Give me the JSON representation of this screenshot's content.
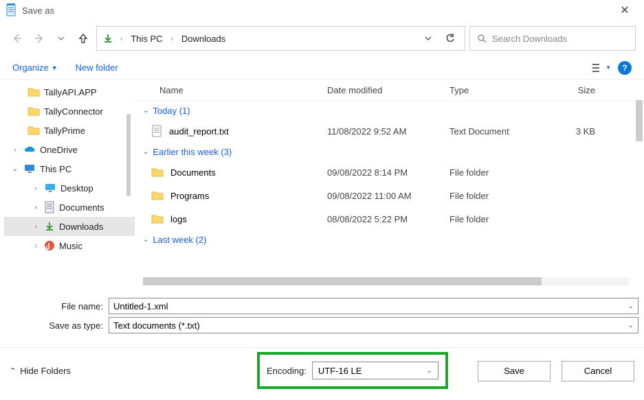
{
  "title": "Save as",
  "breadcrumbs": [
    "This PC",
    "Downloads"
  ],
  "search_placeholder": "Search Downloads",
  "toolbar": {
    "organize": "Organize",
    "new_folder": "New folder"
  },
  "tree": [
    {
      "label": "TallyAPI.APP",
      "icon": "folder",
      "indent": 1
    },
    {
      "label": "TallyConnector",
      "icon": "folder",
      "indent": 1
    },
    {
      "label": "TallyPrime",
      "icon": "folder",
      "indent": 1
    },
    {
      "label": "OneDrive",
      "icon": "onedrive",
      "indent": 0,
      "exp": ">"
    },
    {
      "label": "This PC",
      "icon": "pc",
      "indent": 0,
      "exp": "v"
    },
    {
      "label": "Desktop",
      "icon": "desktop",
      "indent": 2,
      "exp": ">"
    },
    {
      "label": "Documents",
      "icon": "doc",
      "indent": 2,
      "exp": ">"
    },
    {
      "label": "Downloads",
      "icon": "download",
      "indent": 2,
      "exp": ">",
      "selected": true
    },
    {
      "label": "Music",
      "icon": "music",
      "indent": 2,
      "exp": ">"
    }
  ],
  "columns": {
    "name": "Name",
    "date": "Date modified",
    "type": "Type",
    "size": "Size"
  },
  "groups": [
    {
      "label": "Today (1)",
      "rows": [
        {
          "name": "audit_report.txt",
          "icon": "txt",
          "date": "11/08/2022 9:52 AM",
          "type": "Text Document",
          "size": "3 KB"
        }
      ]
    },
    {
      "label": "Earlier this week (3)",
      "rows": [
        {
          "name": "Documents",
          "icon": "folder",
          "date": "09/08/2022 8:14 PM",
          "type": "File folder",
          "size": ""
        },
        {
          "name": "Programs",
          "icon": "folder",
          "date": "09/08/2022 11:00 AM",
          "type": "File folder",
          "size": ""
        },
        {
          "name": "logs",
          "icon": "folder",
          "date": "08/08/2022 5:22 PM",
          "type": "File folder",
          "size": ""
        }
      ]
    },
    {
      "label": "Last week (2)",
      "rows": []
    }
  ],
  "filename_label": "File name:",
  "filename_value": "Untitled-1.xml",
  "savetype_label": "Save as type:",
  "savetype_value": "Text documents (*.txt)",
  "hide_folders": "Hide Folders",
  "encoding_label": "Encoding:",
  "encoding_value": "UTF-16 LE",
  "save_btn": "Save",
  "cancel_btn": "Cancel"
}
